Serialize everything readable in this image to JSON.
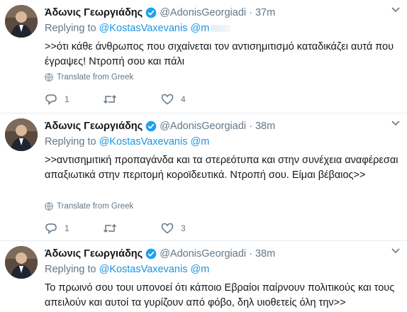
{
  "tweets": [
    {
      "name": "Άδωνις Γεωργιάδης",
      "handle": "@AdonisGeorgiadi",
      "dot": "·",
      "time": "37m",
      "replying_prefix": "Replying to",
      "reply_user1": "@KostasVaxevanis",
      "reply_user2": "@m",
      "text": ">>ότι κάθε άνθρωπος που σιχαίνεται τον αντισημιτισμό καταδικάζει αυτά που έγραψες! Ντροπή σου και πάλι",
      "translate": "Translate from Greek",
      "replies": "1",
      "retweets": "",
      "likes": "4"
    },
    {
      "name": "Άδωνις Γεωργιάδης",
      "handle": "@AdonisGeorgiadi",
      "dot": "·",
      "time": "38m",
      "replying_prefix": "Replying to",
      "reply_user1": "@KostasVaxevanis",
      "reply_user2": "@m",
      "text": ">>αντισημιτική προπαγάνδα και τα στερεότυπα και στην συνέχεια αναφέρεσαι απαξιωτικά στην περιτομή κοροϊδευτικά. Ντροπή σου. Είμαι βέβαιος>>",
      "translate": "Translate from Greek",
      "replies": "1",
      "retweets": "",
      "likes": "3"
    },
    {
      "name": "Άδωνις Γεωργιάδης",
      "handle": "@AdonisGeorgiadi",
      "dot": "·",
      "time": "38m",
      "replying_prefix": "Replying to",
      "reply_user1": "@KostasVaxevanis",
      "reply_user2": "@m",
      "text": "Το πρωινό σου τουι υπονοεί ότι κάποιο Εβραίοι παίρνουν πολιτικούς και τους απειλούν και αυτοί τα γυρίζουν από φόβο, δηλ υιοθετείς όλη την>>"
    }
  ],
  "colors": {
    "link": "#1b95e0",
    "muted": "#657786",
    "text": "#14171a",
    "verified": "#1da1f2",
    "divider": "#e6ecf0"
  },
  "icons": [
    "verified-badge-icon",
    "caret-down-icon",
    "globe-icon",
    "reply-icon",
    "retweet-icon",
    "like-icon"
  ]
}
